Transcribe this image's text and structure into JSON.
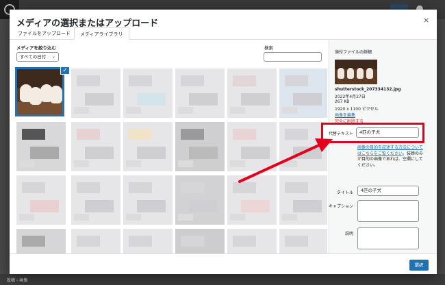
{
  "modal": {
    "title": "メディアの選択またはアップロード",
    "close": "×",
    "tabs": [
      "ファイルをアップロード",
      "メディアライブラリ"
    ]
  },
  "toolbar": {
    "filter_label": "メディアを絞り込む",
    "date_select": "すべての日付",
    "search_label": "検索"
  },
  "attachment": {
    "heading": "添付ファイルの詳細",
    "filename": "shutterstock_207334132.jpg",
    "date": "2022年4月27日",
    "size": "267 KB",
    "dimensions": "1920 x 1100 ピクセル",
    "edit_link": "画像を編集",
    "delete_link": "完全に削除する"
  },
  "fields": {
    "alt_label": "代替テキスト",
    "alt_value": "4匹の子犬",
    "alt_help_link": "画像の目的を記述する方法についてはこちらをご覧ください",
    "alt_help_rest": "。装飾のみが目的の画像であれば、空欄にしてください。",
    "title_label": "タイトル",
    "title_value": "4匹の子犬",
    "caption_label": "キャプション",
    "description_label": "説明"
  },
  "footer": {
    "select_button": "選択"
  },
  "background": {
    "crumb": "投稿 › 画像"
  },
  "colors": {
    "primary": "#2271b1",
    "highlight": "#e3001b"
  }
}
